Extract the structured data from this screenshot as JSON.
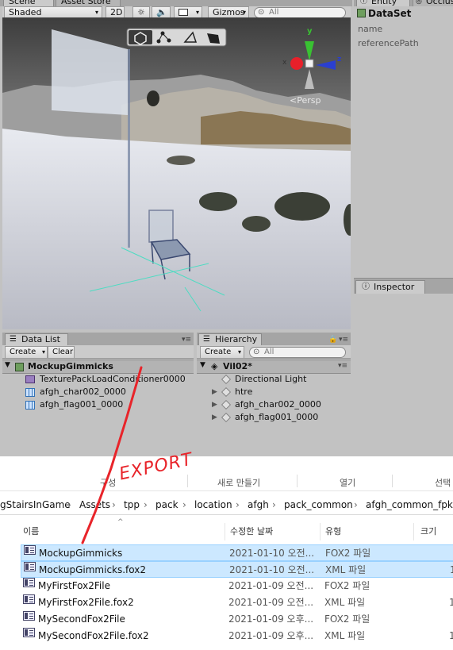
{
  "tabs": {
    "scene": "Scene",
    "asset_store": "Asset Store",
    "entity": "Entity",
    "occlusion": "Occlus"
  },
  "scene_toolbar": {
    "shading": "Shaded",
    "mode_2d": "2D",
    "gizmos": "Gizmos",
    "search_placeholder": "All"
  },
  "gizmo": {
    "y": "y",
    "x": "x",
    "z": "z",
    "persp": "<Persp"
  },
  "entity_panel": {
    "title": "DataSet",
    "fields": [
      "name",
      "referencePath"
    ]
  },
  "inspector": {
    "title": "Inspector"
  },
  "data_list": {
    "tab": "Data List",
    "create": "Create",
    "clear": "Clear",
    "root": "MockupGimmicks",
    "items": [
      "TexturePackLoadConditioner0000",
      "afgh_char002_0000",
      "afgh_flag001_0000"
    ]
  },
  "hierarchy": {
    "tab": "Hierarchy",
    "create": "Create",
    "search_placeholder": "All",
    "scene": "Vil02*",
    "items": [
      "Directional Light",
      "htre",
      "afgh_char002_0000",
      "afgh_flag001_0000"
    ]
  },
  "annotation": {
    "text": "EXPORT",
    "color": "#e8242a"
  },
  "explorer": {
    "ribbon": [
      "구성",
      "새로 만들기",
      "열기",
      "선택"
    ],
    "breadcrumb": [
      "gStairsInGame",
      "Assets",
      "tpp",
      "pack",
      "location",
      "afgh",
      "pack_common",
      "afgh_common_fpkd"
    ],
    "columns": [
      "이름",
      "수정한 날짜",
      "유형",
      "크기"
    ],
    "files": [
      {
        "name": "MockupGimmicks",
        "date": "2021-01-10 오전...",
        "type": "FOX2 파일",
        "size": "",
        "selected": true
      },
      {
        "name": "MockupGimmicks.fox2",
        "date": "2021-01-10 오전...",
        "type": "XML 파일",
        "size": "1",
        "selected": true
      },
      {
        "name": "MyFirstFox2File",
        "date": "2021-01-09 오전...",
        "type": "FOX2 파일",
        "size": "",
        "selected": false
      },
      {
        "name": "MyFirstFox2File.fox2",
        "date": "2021-01-09 오전...",
        "type": "XML 파일",
        "size": "1",
        "selected": false
      },
      {
        "name": "MySecondFox2File",
        "date": "2021-01-09 오후...",
        "type": "FOX2 파일",
        "size": "",
        "selected": false
      },
      {
        "name": "MySecondFox2File.fox2",
        "date": "2021-01-09 오후...",
        "type": "XML 파일",
        "size": "1",
        "selected": false
      }
    ]
  }
}
